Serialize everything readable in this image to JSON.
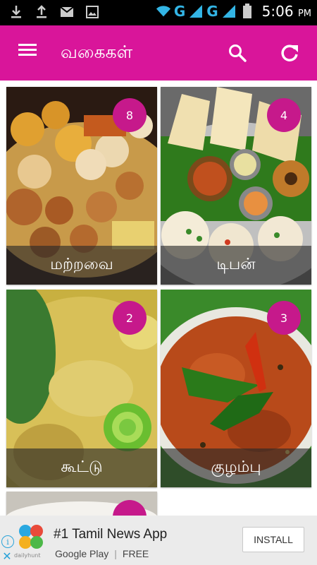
{
  "status_bar": {
    "icons": [
      "download-icon",
      "upload-icon",
      "gmail-icon",
      "image-icon",
      "wifi-icon",
      "signal-icon",
      "battery-icon"
    ],
    "network_1": "G",
    "network_2": "G",
    "time": "5:06",
    "ampm": "PM"
  },
  "app_bar": {
    "title": "வகைகள்",
    "color": "#d9159a",
    "actions": [
      "search-icon",
      "refresh-icon"
    ]
  },
  "categories": [
    {
      "label": "மற்றவை",
      "count": "8"
    },
    {
      "label": "டிபன்",
      "count": "4"
    },
    {
      "label": "கூட்டு",
      "count": "2"
    },
    {
      "label": "குழம்பு",
      "count": "3"
    }
  ],
  "ad": {
    "title": "#1 Tamil News App",
    "store": "Google Play",
    "price": "FREE",
    "install": "INSTALL",
    "brand": "dailyhunt",
    "info": "i",
    "close": "✕"
  },
  "colors": {
    "accent": "#d9159a",
    "badge": "#c6198b"
  }
}
